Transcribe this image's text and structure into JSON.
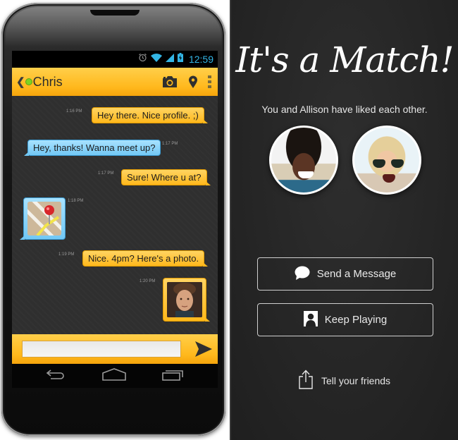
{
  "left_app": {
    "status_bar": {
      "time": "12:59",
      "icons": [
        "alarm-icon",
        "wifi-icon",
        "signal-icon",
        "battery-charging-icon"
      ]
    },
    "action_bar": {
      "back_icon": "chevron-left-icon",
      "online_status": "online",
      "contact_name": "Chris",
      "actions": [
        "camera-icon",
        "location-pin-icon",
        "overflow-menu-icon"
      ]
    },
    "messages": [
      {
        "direction": "out",
        "type": "text",
        "text": "Hey there. Nice profile. ;)",
        "time": "1:16 PM"
      },
      {
        "direction": "in",
        "type": "text",
        "text": "Hey, thanks! Wanna meet up?",
        "time": "1:17 PM"
      },
      {
        "direction": "out",
        "type": "text",
        "text": "Sure! Where u at?",
        "time": "1:17 PM"
      },
      {
        "direction": "in",
        "type": "location",
        "text": "",
        "time": "1:18 PM"
      },
      {
        "direction": "out",
        "type": "text",
        "text": "Nice. 4pm? Here's a photo.",
        "time": "1:19 PM"
      },
      {
        "direction": "out",
        "type": "photo",
        "text": "",
        "time": "1:20 PM"
      }
    ],
    "composer": {
      "value": "",
      "placeholder": "",
      "send_icon": "send-icon"
    },
    "nav_bar": [
      "back-icon",
      "home-icon",
      "recent-apps-icon"
    ],
    "colors": {
      "accent": "#ffb81c",
      "incoming": "#72c8f5",
      "status": "#33b5e5"
    }
  },
  "right_app": {
    "title": "It's a Match!",
    "subtitle": "You and Allison have liked each other.",
    "avatars": [
      "your-photo",
      "allison-photo"
    ],
    "buttons": [
      {
        "label": "Send a Message",
        "icon": "speech-bubble-icon"
      },
      {
        "label": "Keep Playing",
        "icon": "person-card-icon"
      }
    ],
    "share": {
      "label": "Tell your friends",
      "icon": "share-icon"
    }
  }
}
